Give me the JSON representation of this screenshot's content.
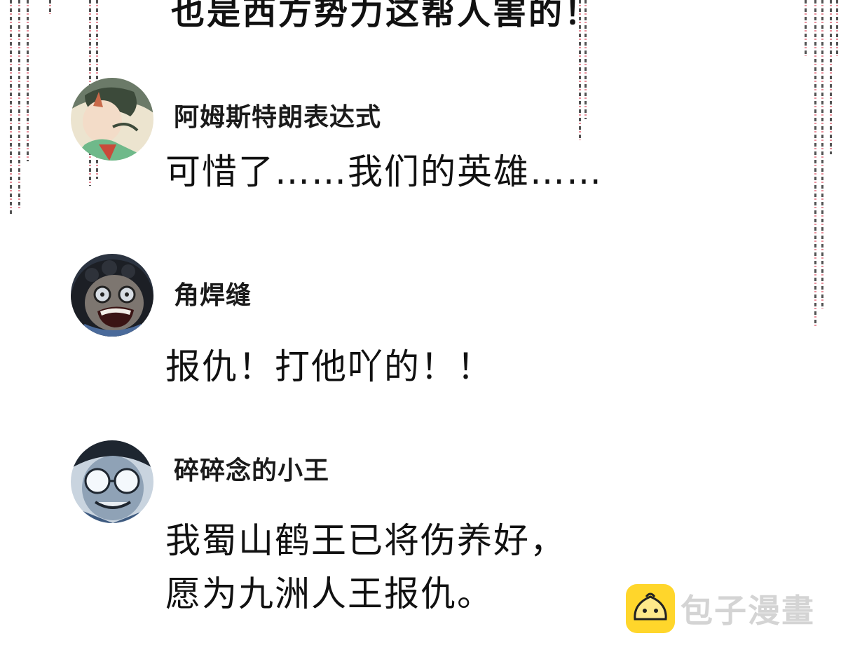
{
  "top_caption": "也是西方势力这帮人害的！",
  "comments": [
    {
      "username": "阿姆斯特朗表达式",
      "message_lines": [
        "可惜了……我们的英雄……"
      ],
      "avatar_icon": "green-robed-character-avatar"
    },
    {
      "username": "角焊缝",
      "message_lines": [
        "报仇！打他吖的！！"
      ],
      "avatar_icon": "shouting-curly-hair-avatar"
    },
    {
      "username": "碎碎念的小王",
      "message_lines": [
        "我蜀山鹤王已将伤养好，",
        "愿为九洲人王报仇。"
      ],
      "avatar_icon": "glasses-grin-avatar"
    }
  ],
  "watermark": {
    "text": "包子漫畫",
    "icon": "steamed-bun-icon",
    "icon_color": "#ffd62b"
  }
}
